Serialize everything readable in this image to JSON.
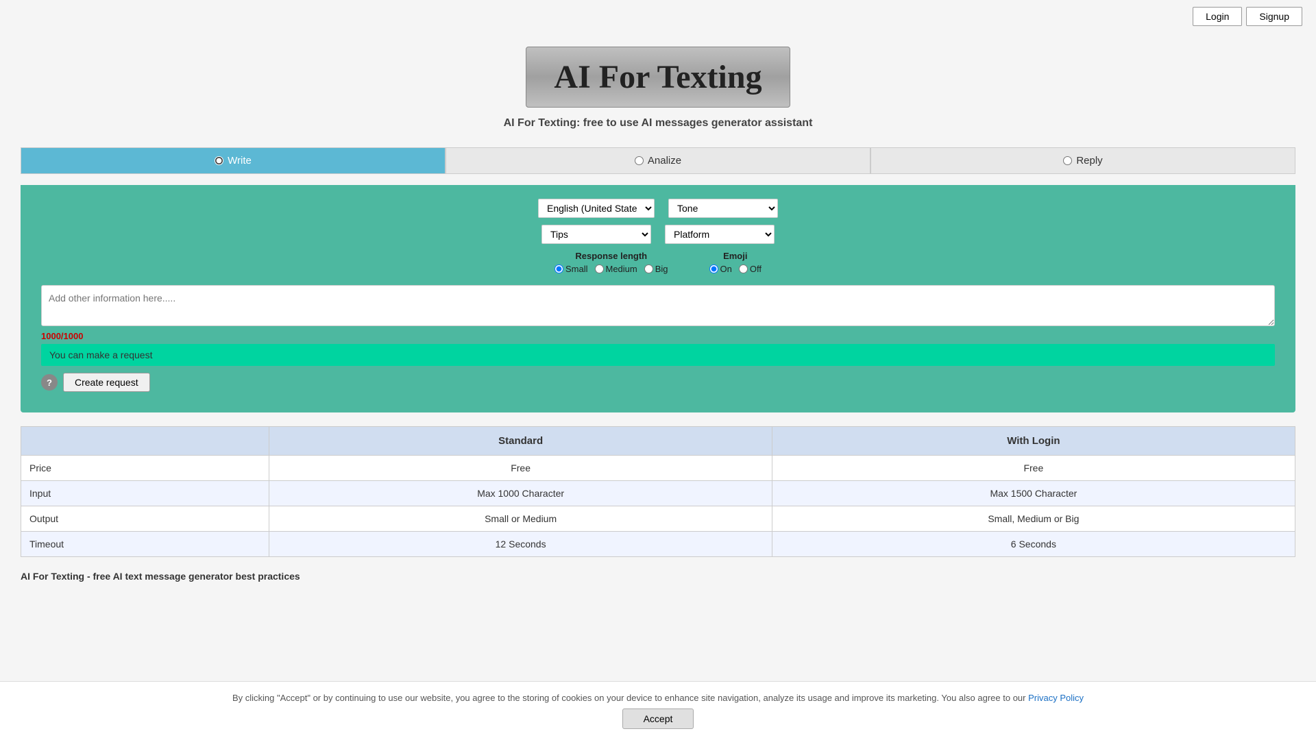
{
  "header": {
    "login_label": "Login",
    "signup_label": "Signup"
  },
  "logo": {
    "title": "AI For Texting",
    "subtitle": "AI For Texting: free to use AI messages generator assistant"
  },
  "modes": [
    {
      "id": "write",
      "label": "Write",
      "active": true
    },
    {
      "id": "analize",
      "label": "Analize",
      "active": false
    },
    {
      "id": "reply",
      "label": "Reply",
      "active": false
    }
  ],
  "controls": {
    "language_default": "English (United State",
    "tone_label": "Tone",
    "topic_default": "Tips",
    "platform_label": "Platform"
  },
  "response_length": {
    "label": "Response length",
    "options": [
      "Small",
      "Medium",
      "Big"
    ],
    "selected": "Small"
  },
  "emoji": {
    "label": "Emoji",
    "options": [
      "On",
      "Off"
    ],
    "selected": "On"
  },
  "textarea": {
    "placeholder": "Add other information here.....",
    "char_count": "1000/1000"
  },
  "status": {
    "message": "You can make a request"
  },
  "buttons": {
    "help": "?",
    "create_request": "Create request"
  },
  "pricing": {
    "col_feature": "",
    "col_standard": "Standard",
    "col_login": "With Login",
    "rows": [
      {
        "feature": "Price",
        "standard": "Free",
        "login": "Free"
      },
      {
        "feature": "Input",
        "standard": "Max 1000 Character",
        "login": "Max 1500 Character"
      },
      {
        "feature": "Output",
        "standard": "Small or Medium",
        "login": "Small, Medium or Big"
      },
      {
        "feature": "Timeout",
        "standard": "12 Seconds",
        "login": "6 Seconds"
      }
    ]
  },
  "best_practices": {
    "text": "AI For Texting - free AI text message generator best practices"
  },
  "cookie": {
    "message": "By clicking \"Accept\" or by continuing to use our website, you agree to the storing of cookies on your device to enhance site navigation, analyze its usage and improve its marketing. You also agree to our",
    "privacy_link": "Privacy Policy",
    "accept_label": "Accept"
  }
}
